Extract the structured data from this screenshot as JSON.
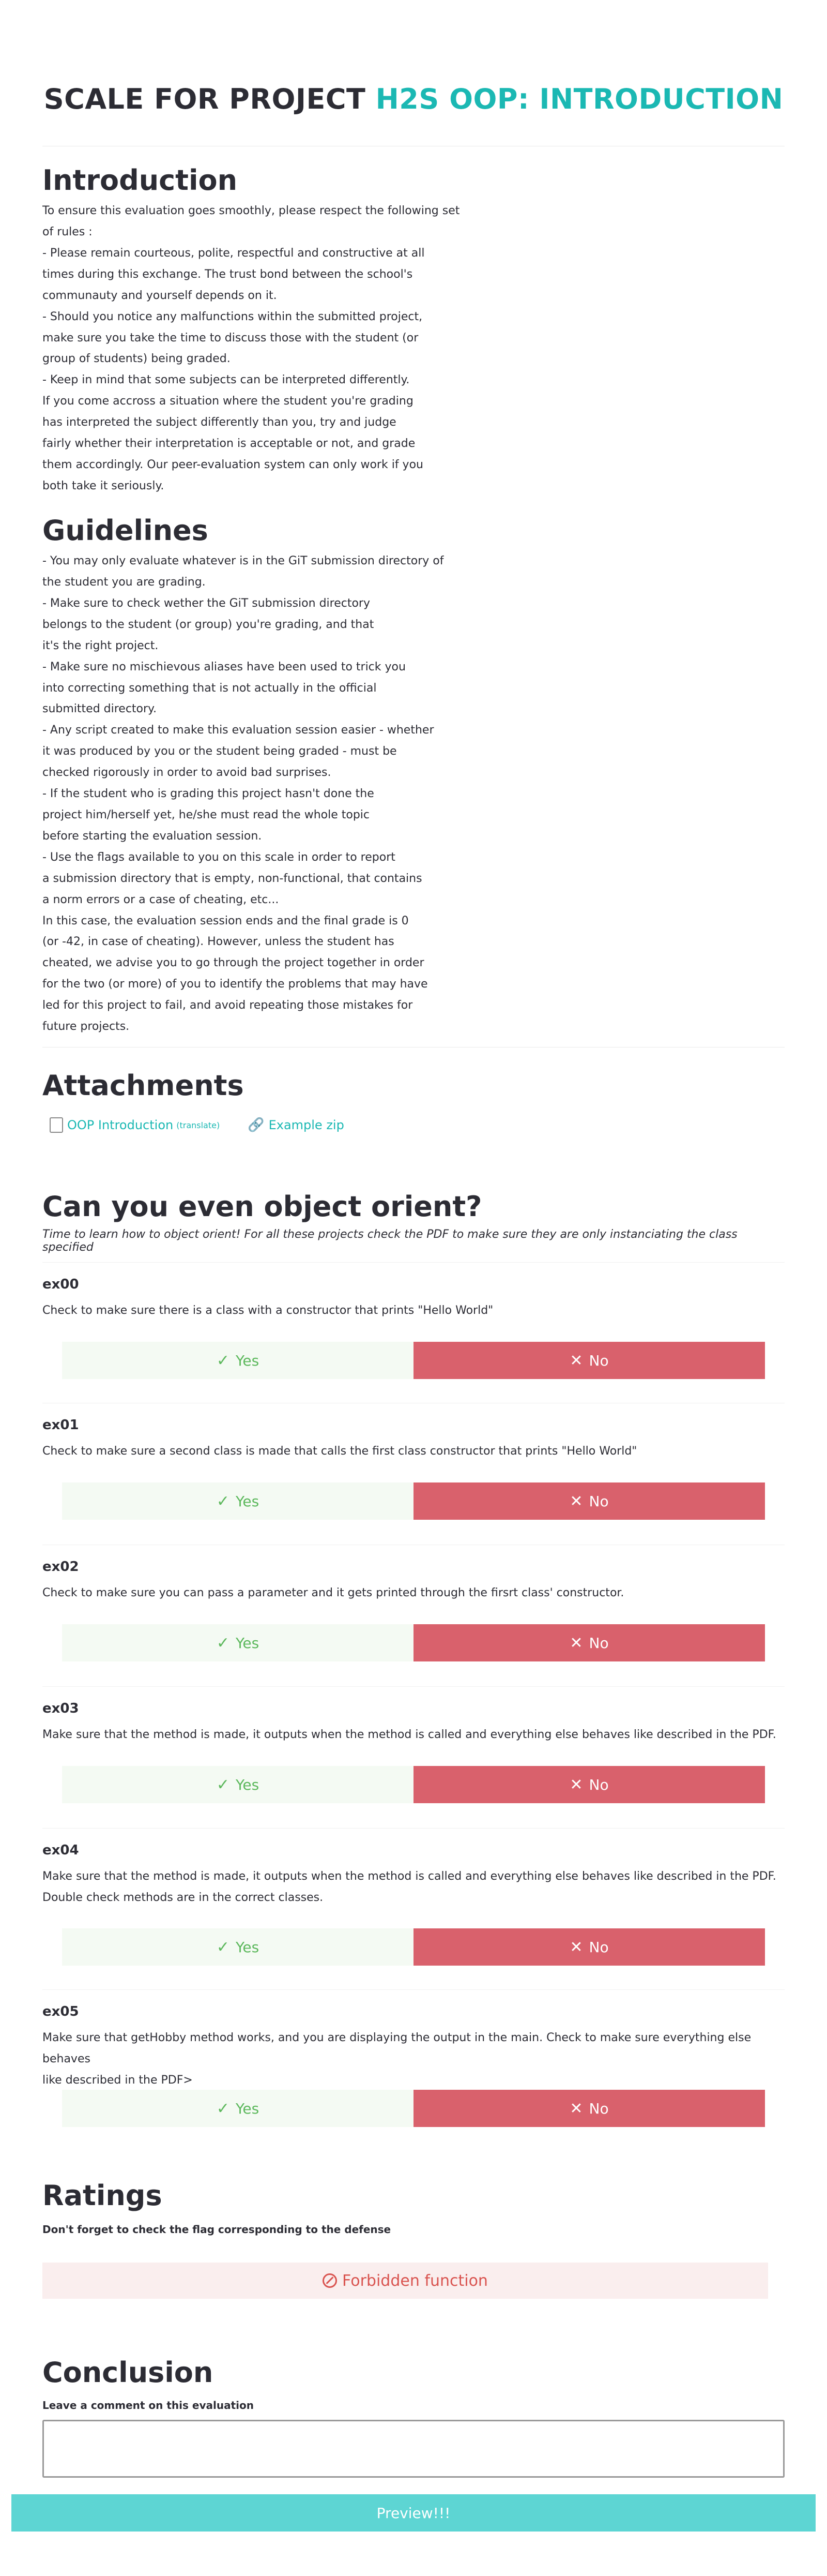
{
  "header": {
    "title_prefix": "SCALE FOR PROJECT ",
    "title_project": "H2S OOP: INTRODUCTION"
  },
  "introduction": {
    "heading": "Introduction",
    "text": "To ensure this evaluation goes smoothly, please respect the following set\nof rules :\n- Please remain courteous, polite, respectful and constructive at all\ntimes during this exchange. The trust bond between the school's\ncommunauty and yourself depends on it.\n- Should you notice any malfunctions within the submitted project,\nmake sure you take the time to discuss those with the student (or\ngroup of students) being graded.\n- Keep in mind that some subjects can be interpreted differently.\nIf you come accross a situation where the student you're grading\nhas interpreted the subject differently than you, try and judge\nfairly whether their interpretation is acceptable or not, and grade\nthem accordingly. Our peer-evaluation system can only work if you\nboth take it seriously."
  },
  "guidelines": {
    "heading": "Guidelines",
    "text": "- You may only evaluate whatever is in the GiT submission directory of\nthe student you are grading.\n- Make sure to check wether the GiT submission directory\nbelongs to the student (or group) you're grading, and that\nit's the right project.\n- Make sure no mischievous aliases have been used to trick you\ninto correcting something that is not actually in the official\nsubmitted directory.\n- Any script created to make this evaluation session easier - whether\nit was produced by you or the student being graded - must be\nchecked rigorously in order to avoid bad surprises.\n- If the student who is grading this project hasn't done the\nproject him/herself yet, he/she must read the whole topic\nbefore starting the evaluation session.\n- Use the flags available to you on this scale in order to report\na submission directory that is empty, non-functional, that contains\na norm errors or a case of cheating, etc...\nIn this case, the evaluation session ends and the final grade is 0\n(or -42, in case of cheating). However, unless the student has\ncheated, we advise you to go through the project together in order\nfor the two (or more) of you to identify the problems that may have\nled for this project to fail, and avoid repeating those mistakes for\nfuture projects."
  },
  "attachments": {
    "heading": "Attachments",
    "file_label": "OOP Introduction",
    "file_translate": "(translate)",
    "link_label": "Example zip"
  },
  "section": {
    "heading": "Can you even object orient?",
    "subtitle": "Time to learn how to object orient! For all these projects check the PDF to make sure they are only instanciating the class specified"
  },
  "buttons": {
    "yes": "Yes",
    "no": "No"
  },
  "questions": [
    {
      "name": "ex00",
      "desc": "Check to make sure there is a class with a constructor that prints \"Hello World\""
    },
    {
      "name": "ex01",
      "desc": "Check to make sure a second class is made that calls the first class constructor that prints \"Hello World\""
    },
    {
      "name": "ex02",
      "desc": "Check to make sure you can pass a parameter and it gets printed through the firsrt class' constructor."
    },
    {
      "name": "ex03",
      "desc": "Make sure that the method is made, it outputs when the method is called and everything else behaves like described in the PDF."
    },
    {
      "name": "ex04",
      "desc": "Make sure that the method is made, it outputs when the method is called and everything else behaves like described in the PDF.\nDouble check methods are in the correct classes."
    },
    {
      "name": "ex05",
      "desc": "Make sure that getHobby method works, and you are displaying the output in the main. Check to make sure everything else behaves\nlike described in the PDF>"
    }
  ],
  "ratings": {
    "heading": "Ratings",
    "note": "Don't forget to check the flag corresponding to the defense",
    "flag_label": "Forbidden function"
  },
  "conclusion": {
    "heading": "Conclusion",
    "note": "Leave a comment on this evaluation",
    "comment_value": ""
  },
  "preview_label": "Preview!!!"
}
